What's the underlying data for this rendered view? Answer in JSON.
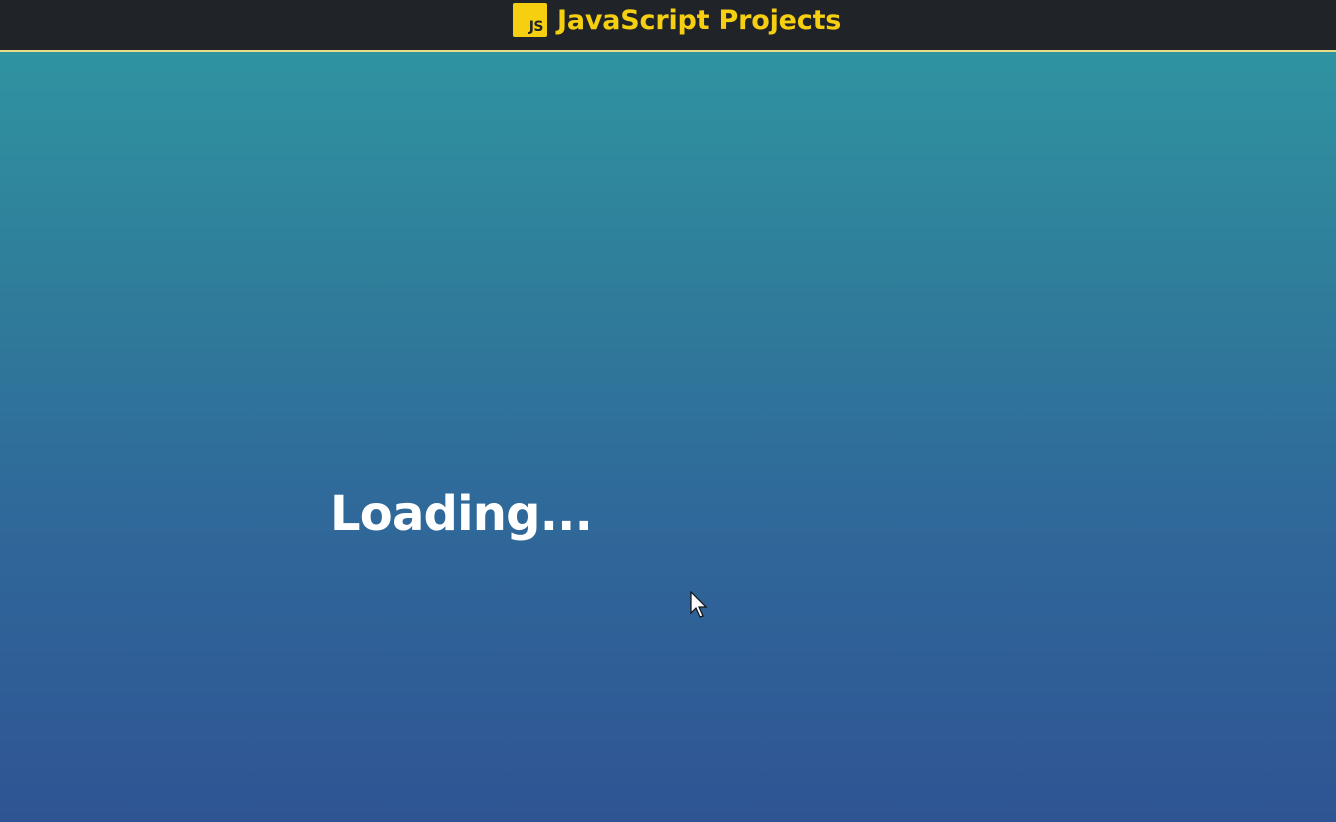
{
  "header": {
    "logo_text": "JS",
    "title": "JavaScript Projects"
  },
  "main": {
    "loading_text": "Loading..."
  },
  "colors": {
    "header_bg": "#202328",
    "accent_yellow": "#f6cf11",
    "header_border": "#e9dc89",
    "background_top": "#2f98a2",
    "background_bottom": "#2f5493",
    "loading_text": "#ffffff"
  },
  "icons": {
    "logo": "js-logo-icon",
    "pointer": "mouse-pointer-icon"
  }
}
